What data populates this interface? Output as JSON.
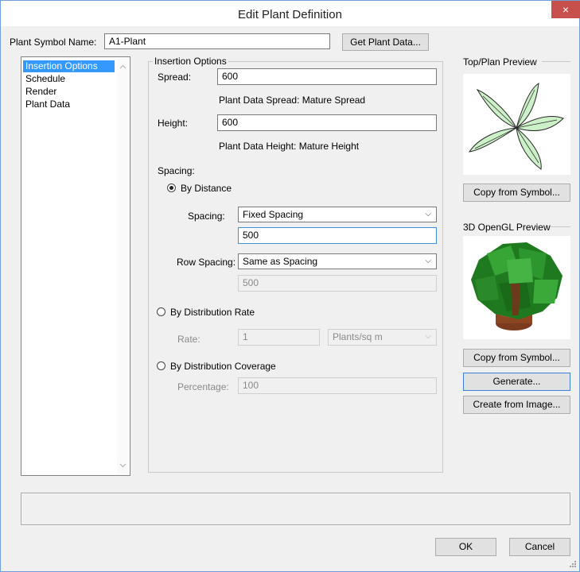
{
  "window": {
    "title": "Edit Plant Definition",
    "close_glyph": "×"
  },
  "symbol": {
    "label": "Plant Symbol Name:",
    "value": "A1-Plant",
    "get_button": "Get Plant Data..."
  },
  "nav": {
    "items": [
      "Insertion Options",
      "Schedule",
      "Render",
      "Plant Data"
    ],
    "selected": 0
  },
  "insertion": {
    "legend": "Insertion Options",
    "spread_label": "Spread:",
    "spread_value": "600",
    "spread_note": "Plant Data Spread: Mature Spread",
    "height_label": "Height:",
    "height_value": "600",
    "height_note": "Plant Data Height: Mature Height",
    "spacing_header": "Spacing:",
    "by_distance": "By Distance",
    "spacing_label": "Spacing:",
    "spacing_select": "Fixed Spacing",
    "spacing_value": "500",
    "row_spacing_label": "Row Spacing:",
    "row_spacing_select": "Same as Spacing",
    "row_spacing_value": "500",
    "by_rate": "By Distribution Rate",
    "rate_label": "Rate:",
    "rate_value": "1",
    "rate_unit": "Plants/sq m",
    "by_coverage": "By Distribution Coverage",
    "percentage_label": "Percentage:",
    "percentage_value": "100",
    "selected_mode": "By Distance"
  },
  "preview": {
    "top_plan_label": "Top/Plan Preview",
    "copy_symbol_1": "Copy from Symbol...",
    "opengl_label": "3D OpenGL Preview",
    "copy_symbol_2": "Copy from Symbol...",
    "generate": "Generate...",
    "create_image": "Create from Image..."
  },
  "footer": {
    "ok": "OK",
    "cancel": "Cancel"
  },
  "colors": {
    "accent": "#3399ff",
    "close": "#c74f4c",
    "leaf": "#ccf0c8",
    "foliage": "#2f8f2f",
    "trunk": "#7a3b1e"
  }
}
